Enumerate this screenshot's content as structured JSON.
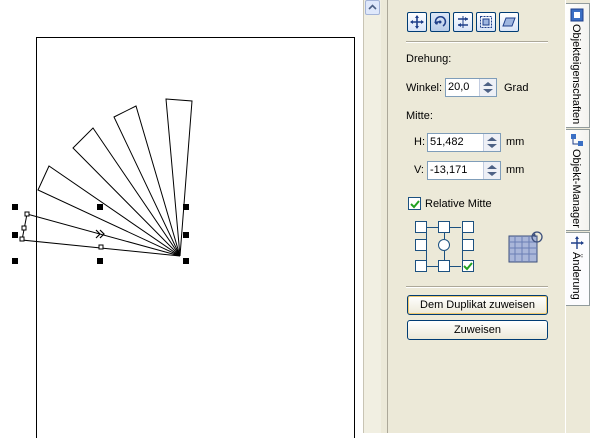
{
  "toolbar": {
    "buttons": [
      {
        "name": "position-tool-button",
        "icon": "position-icon"
      },
      {
        "name": "rotate-tool-button",
        "icon": "rotate-icon"
      },
      {
        "name": "scale-mirror-tool-button",
        "icon": "scale-mirror-icon"
      },
      {
        "name": "size-tool-button",
        "icon": "size-icon"
      },
      {
        "name": "skew-tool-button",
        "icon": "skew-icon"
      }
    ]
  },
  "rotation": {
    "section_label": "Drehung:",
    "angle_label": "Winkel:",
    "angle_value": "20,0",
    "angle_unit": "Grad"
  },
  "center": {
    "section_label": "Mitte:",
    "h_label": "H:",
    "h_value": "51,482",
    "h_unit": "mm",
    "v_label": "V:",
    "v_value": "-13,171",
    "v_unit": "mm",
    "relative_label": "Relative Mitte",
    "relative_checked": true
  },
  "buttons": {
    "apply_duplicate": "Dem Duplikat zuweisen",
    "apply": "Zuweisen"
  },
  "tabs": [
    {
      "label": "Objekteigenschaften",
      "icon": "object-properties-icon"
    },
    {
      "label": "Objekt-Manager",
      "icon": "object-manager-icon"
    },
    {
      "label": "Änderung",
      "icon": "transform-icon",
      "active": true
    }
  ],
  "colors": {
    "docker_bg": "#ece9d8",
    "accent_border": "#003c74",
    "check": "#21a121"
  }
}
